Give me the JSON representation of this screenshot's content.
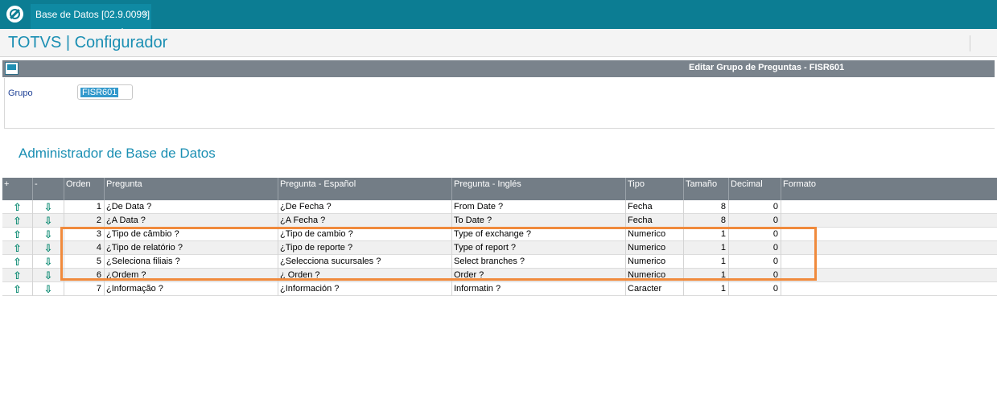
{
  "tab": {
    "label": "Base de Datos [02.9.0099]",
    "close": "×"
  },
  "header": {
    "title": "TOTVS | Configurador"
  },
  "dialog": {
    "title": "Editar Grupo de Preguntas - FISR601"
  },
  "form": {
    "grupo_label": "Grupo",
    "grupo_value": "FISR601"
  },
  "section_title": "Administrador de Base de Datos",
  "colors": {
    "accent": "#0c7d93",
    "title": "#1b8fb3",
    "highlight": "#f08a3c",
    "arrow": "#00856c"
  },
  "grid": {
    "columns": [
      "+",
      "-",
      "Orden",
      "Pregunta",
      "Pregunta - Español",
      "Pregunta - Inglés",
      "Tipo",
      "Tamaño",
      "Decimal",
      "Formato"
    ],
    "icons": {
      "up": "⇧",
      "down": "⇩"
    },
    "rows": [
      {
        "orden": "1",
        "pregunta": "¿De Data ?",
        "espanol": "¿De Fecha ?",
        "ingles": "From Date ?",
        "tipo": "Fecha",
        "tamano": "8",
        "decimal": "0",
        "formato": ""
      },
      {
        "orden": "2",
        "pregunta": "¿A Data ?",
        "espanol": "¿A Fecha ?",
        "ingles": "To Date ?",
        "tipo": "Fecha",
        "tamano": "8",
        "decimal": "0",
        "formato": ""
      },
      {
        "orden": "3",
        "pregunta": "¿Tipo de câmbio ?",
        "espanol": "¿Tipo de cambio ?",
        "ingles": "Type of exchange ?",
        "tipo": "Numerico",
        "tamano": "1",
        "decimal": "0",
        "formato": ""
      },
      {
        "orden": "4",
        "pregunta": "¿Tipo de relatório ?",
        "espanol": "¿Tipo de reporte ?",
        "ingles": "Type of report ?",
        "tipo": "Numerico",
        "tamano": "1",
        "decimal": "0",
        "formato": ""
      },
      {
        "orden": "5",
        "pregunta": "¿Seleciona filiais ?",
        "espanol": "¿Selecciona sucursales ?",
        "ingles": "Select branches ?",
        "tipo": "Numerico",
        "tamano": "1",
        "decimal": "0",
        "formato": ""
      },
      {
        "orden": "6",
        "pregunta": "¿Ordem ?",
        "espanol": "¿ Orden ?",
        "ingles": "Order ?",
        "tipo": "Numerico",
        "tamano": "1",
        "decimal": "0",
        "formato": ""
      },
      {
        "orden": "7",
        "pregunta": "¿Informação ?",
        "espanol": "¿Información ?",
        "ingles": "Informatin ?",
        "tipo": "Caracter",
        "tamano": "1",
        "decimal": "0",
        "formato": ""
      }
    ]
  }
}
